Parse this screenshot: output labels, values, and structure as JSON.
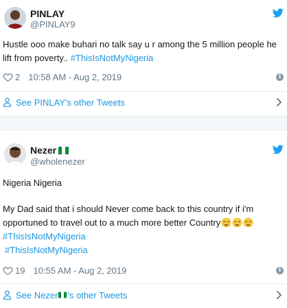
{
  "tweets": [
    {
      "name": "PINLAY",
      "handle": "@PINLAY9",
      "text_plain": "Hustle ooo make buhari no talk say u r among the 5 million people he lift from poverty.. ",
      "hashtag": "#ThisIsNotMyNigeria",
      "likes": "2",
      "timestamp": "10:58 AM - Aug 2, 2019",
      "see_more_prefix": "See PINLAY's other Tweets",
      "see_more_suffix": ""
    },
    {
      "name": "Nezer",
      "handle": "@wholenezer",
      "line1": "Nigeria Nigeria",
      "line2": "My Dad said that i should Never come back to this country if i'm",
      "line3": "opportuned to travel out to a much more better Country",
      "hashtag1": "#ThisIsNotMyNigeria",
      "hashtag2": "#ThisIsNotMyNigeria",
      "likes": "19",
      "timestamp": "10:55 AM - Aug 2, 2019",
      "see_more_prefix": "See Nezer",
      "see_more_suffix": "'s other Tweets"
    }
  ],
  "icons": {
    "brand": "twitter-bird-icon",
    "like": "heart-icon",
    "info": "info-icon",
    "profile": "person-icon",
    "open": "chevron-right-icon",
    "flag": "nigeria-flag-emoji",
    "emoji": "tired-face-emoji"
  },
  "colors": {
    "accent": "#1b95e0",
    "muted": "#657786",
    "text": "#14171a",
    "divider": "#e6ecf0"
  }
}
